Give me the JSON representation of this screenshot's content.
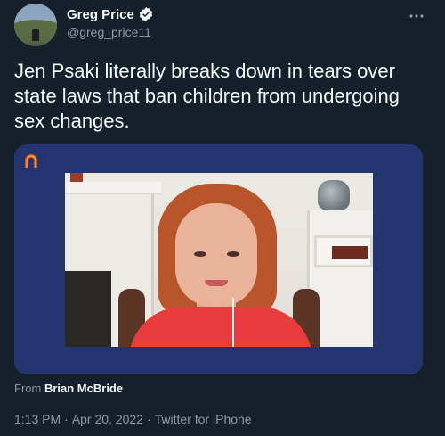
{
  "author": {
    "name": "Greg Price",
    "handle": "@greg_price11",
    "verified": true
  },
  "tweet": {
    "text": "Jen Psaki literally breaks down in tears over state laws that ban children from undergoing sex changes."
  },
  "media": {
    "from_label": "From",
    "source_name": "Brian McBride",
    "card_color": "#24346e",
    "logo_color": "#e24a3b"
  },
  "meta": {
    "time": "1:13 PM",
    "separator1": "·",
    "date": "Apr 20, 2022",
    "separator2": "·",
    "client": "Twitter for iPhone"
  },
  "icons": {
    "verified": "verified-badge-icon",
    "more": "more-options-icon",
    "logo": "network-logo-icon"
  },
  "colors": {
    "background": "#15202b",
    "text": "#f7f9f9",
    "secondary": "#8b98a5"
  }
}
